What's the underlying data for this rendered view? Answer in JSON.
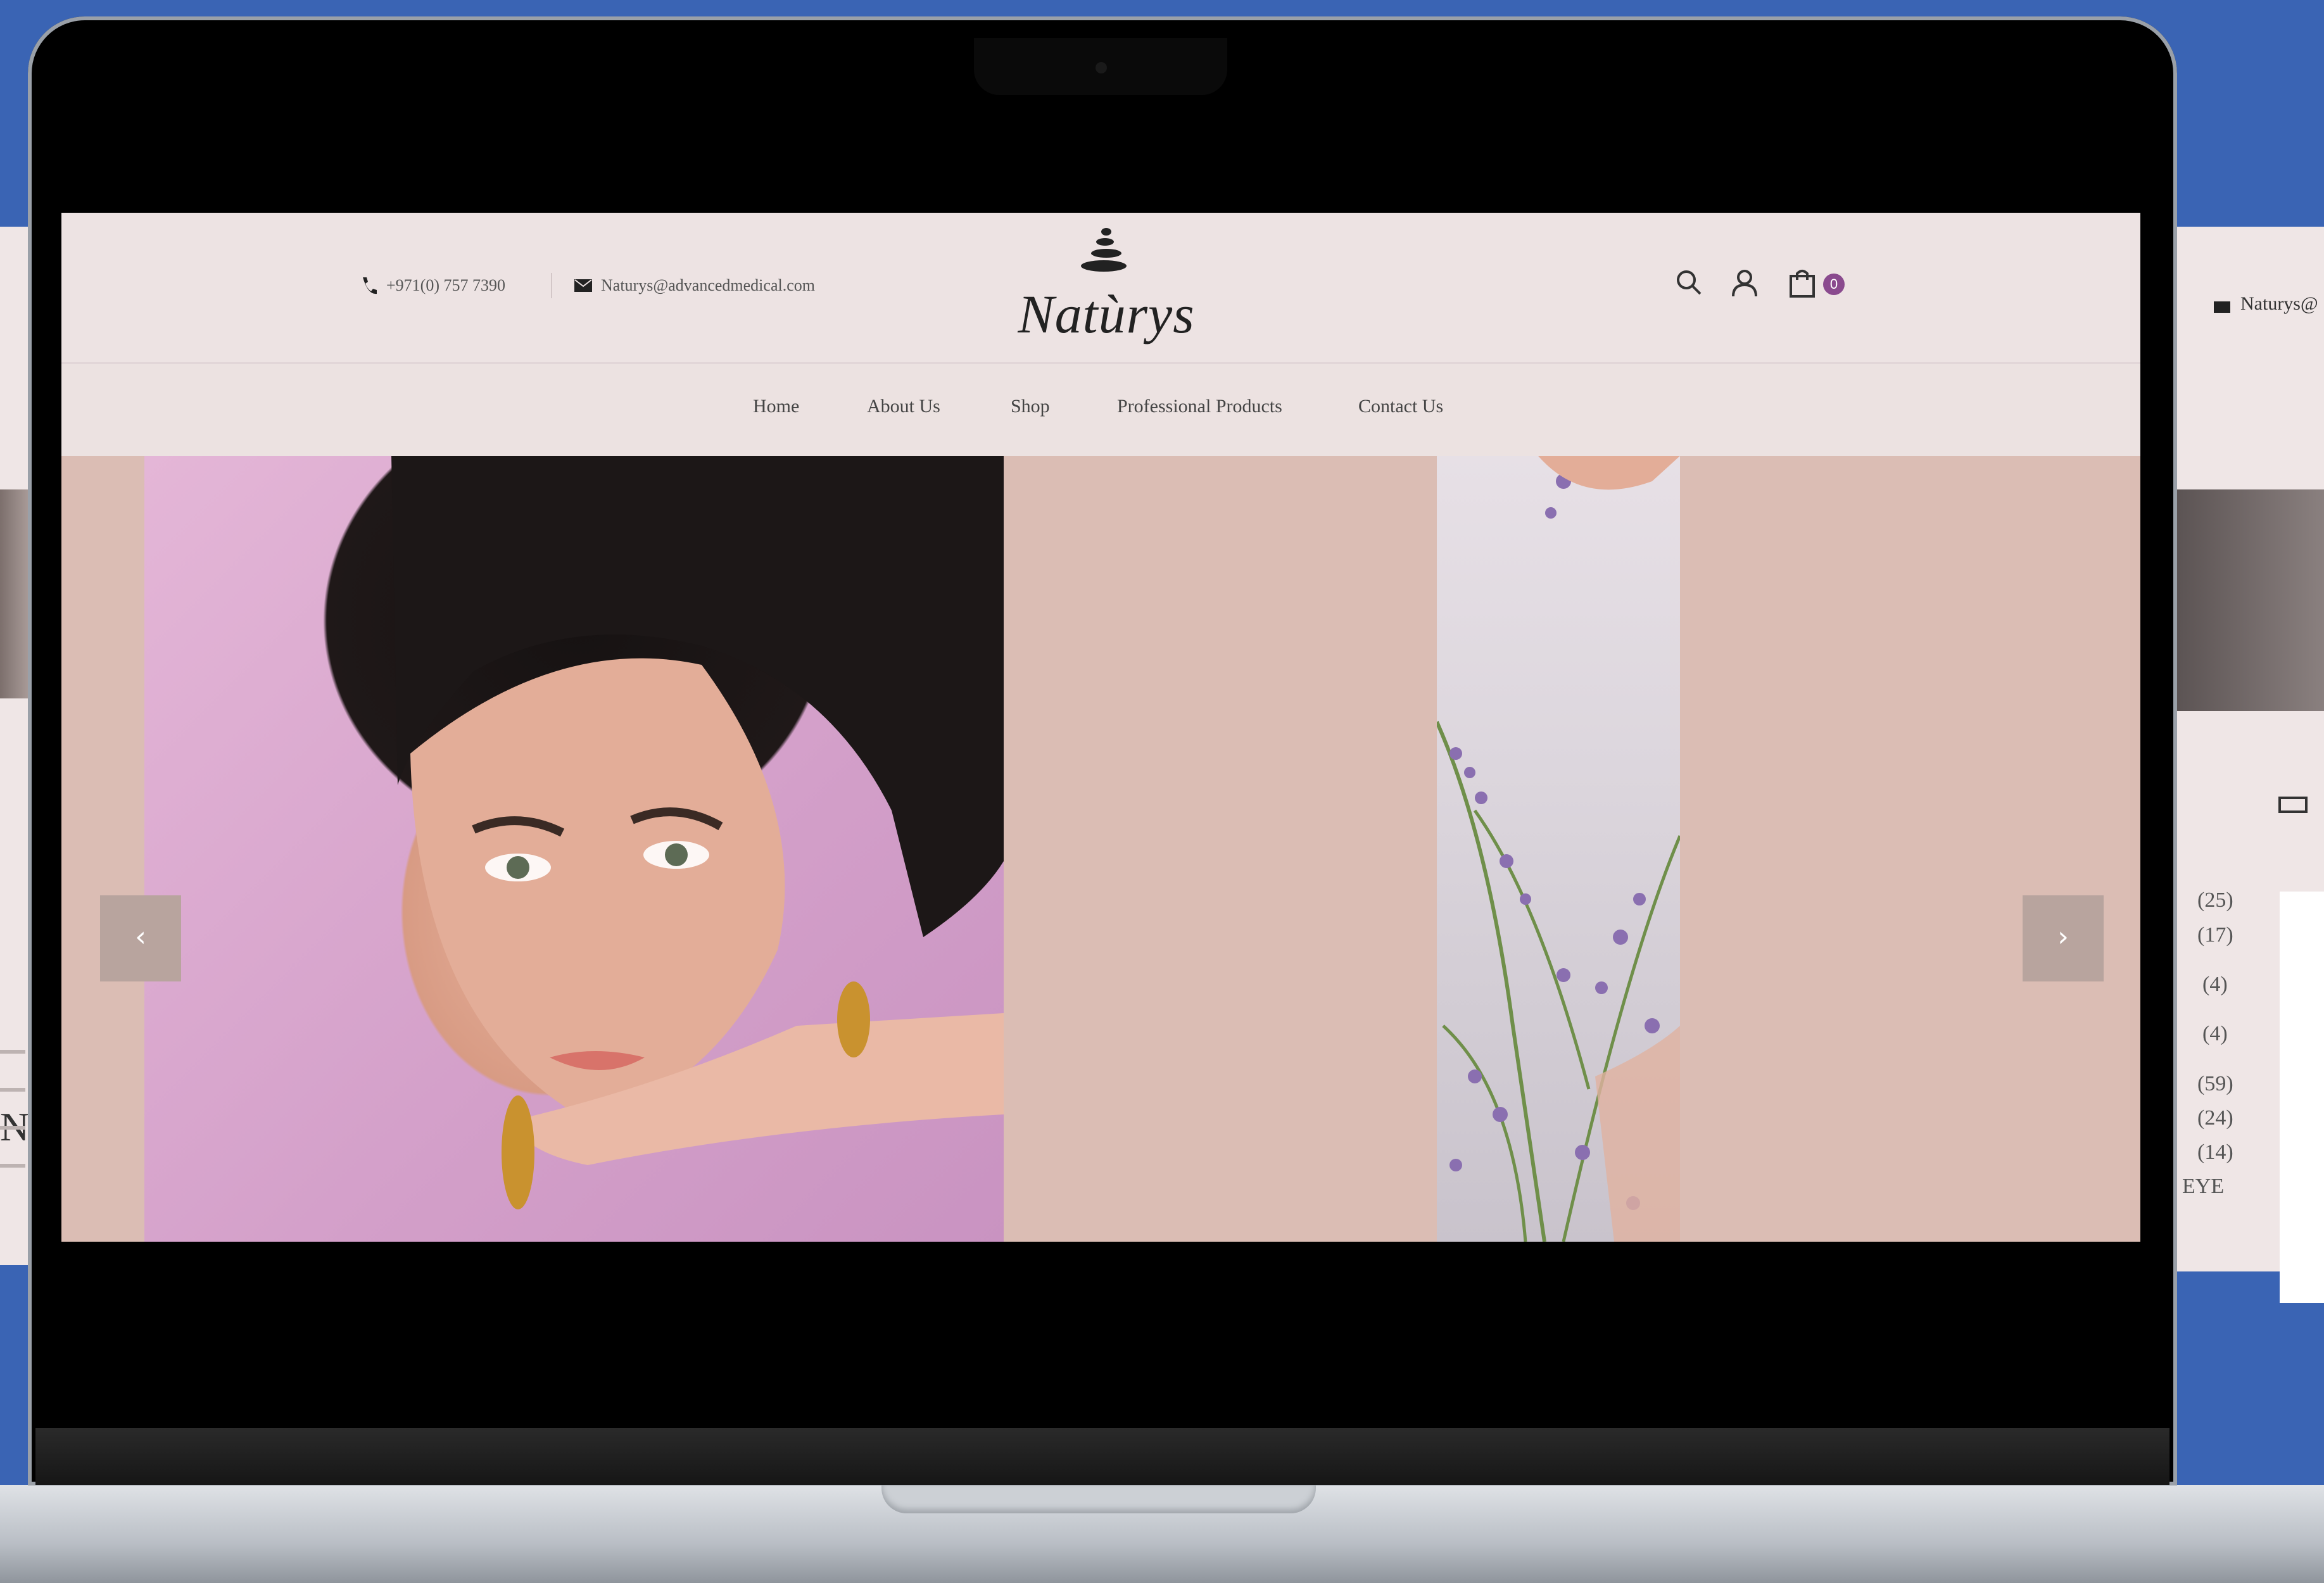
{
  "topbar": {
    "phone": "+971(0) 757 7390",
    "email": "Naturys@advancedmedical.com"
  },
  "logo": {
    "text": "Natùrys"
  },
  "cart": {
    "count": "0"
  },
  "nav": {
    "items": [
      {
        "label": "Home"
      },
      {
        "label": "About Us"
      },
      {
        "label": "Shop"
      },
      {
        "label": "Professional Products"
      },
      {
        "label": "Contact Us"
      }
    ]
  },
  "hero": {
    "prev_arrow": "‹",
    "next_arrow": "›"
  },
  "background_page": {
    "email_fragment": "Naturys@",
    "counts": [
      "(25)",
      "(17)",
      "(4)",
      "(4)",
      "(59)",
      "(24)",
      "(14)"
    ],
    "category_fragment": "EYE",
    "left_glyph": "N"
  },
  "colors": {
    "backdrop": "#3a64b4",
    "header_bg": "#ede3e3",
    "hero_bg": "#dbbdb4",
    "cart_badge": "#8a4a8e"
  }
}
